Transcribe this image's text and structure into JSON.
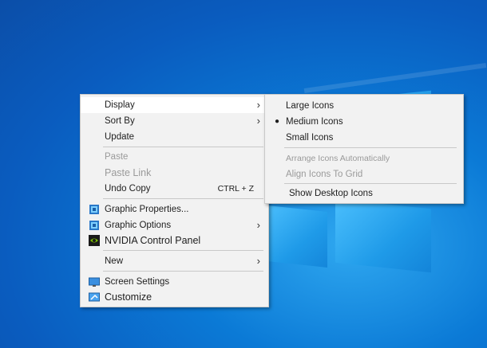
{
  "context_menu": {
    "items": [
      {
        "label": "Display",
        "icon": "",
        "arrow": true
      },
      {
        "label": "Sort By",
        "icon": "",
        "arrow": true
      },
      {
        "label": "Update",
        "icon": ""
      },
      {
        "label": "Paste",
        "icon": ""
      },
      {
        "label": "Paste Link",
        "icon": ""
      },
      {
        "label": "Undo Copy",
        "icon": "",
        "shortcut": "CTRL + Z"
      },
      {
        "label": "Graphic Properties...",
        "icon": "intel-graphics-icon"
      },
      {
        "label": "Graphic Options",
        "icon": "intel-graphics-icon",
        "arrow": true
      },
      {
        "label": "NVIDIA Control Panel",
        "icon": "nvidia-icon"
      },
      {
        "label": "New",
        "icon": "",
        "arrow": true
      },
      {
        "label": "Screen Settings",
        "icon": "display-settings-icon"
      },
      {
        "label": "Customize",
        "icon": "customize-icon"
      }
    ]
  },
  "submenu": {
    "items": [
      {
        "label": "Large Icons"
      },
      {
        "label": "Medium Icons",
        "checked": true
      },
      {
        "label": "Small Icons"
      },
      {
        "label": "Arrange Icons Automatically"
      },
      {
        "label": "Align Icons To Grid"
      },
      {
        "label": "Show Desktop Icons"
      }
    ]
  },
  "colors": {
    "desktop": "#0a5cbf",
    "menu_bg": "#f2f2f2",
    "highlight": "#ffffff",
    "disabled": "#9a9a9a"
  }
}
